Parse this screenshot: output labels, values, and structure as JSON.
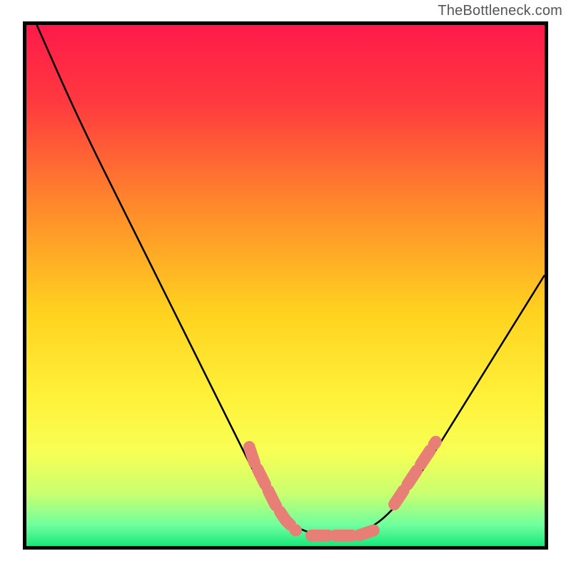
{
  "watermark": "TheBottleneck.com",
  "chart_data": {
    "type": "line",
    "title": "",
    "xlabel": "",
    "ylabel": "",
    "xlim": [
      0,
      100
    ],
    "ylim": [
      0,
      100
    ],
    "series": [
      {
        "name": "main-curve",
        "style": "solid",
        "color": "#000000",
        "points": [
          {
            "x": 2,
            "y": 100
          },
          {
            "x": 10,
            "y": 82
          },
          {
            "x": 20,
            "y": 62
          },
          {
            "x": 30,
            "y": 42
          },
          {
            "x": 40,
            "y": 22
          },
          {
            "x": 48,
            "y": 6
          },
          {
            "x": 55,
            "y": 2
          },
          {
            "x": 62,
            "y": 2
          },
          {
            "x": 68,
            "y": 4
          },
          {
            "x": 75,
            "y": 12
          },
          {
            "x": 85,
            "y": 28
          },
          {
            "x": 95,
            "y": 44
          },
          {
            "x": 100,
            "y": 52
          }
        ]
      },
      {
        "name": "left-marker-band",
        "style": "dashed-markers",
        "color": "#e77f76",
        "points": [
          {
            "x": 43,
            "y": 19
          },
          {
            "x": 44,
            "y": 16
          },
          {
            "x": 46,
            "y": 12
          },
          {
            "x": 48,
            "y": 8
          },
          {
            "x": 50,
            "y": 5
          },
          {
            "x": 52,
            "y": 3
          }
        ]
      },
      {
        "name": "bottom-marker-band",
        "style": "dashed-markers",
        "color": "#e77f76",
        "points": [
          {
            "x": 55,
            "y": 2
          },
          {
            "x": 58,
            "y": 2
          },
          {
            "x": 61,
            "y": 2
          },
          {
            "x": 64,
            "y": 2
          },
          {
            "x": 67,
            "y": 3
          }
        ]
      },
      {
        "name": "right-marker-band",
        "style": "dashed-markers",
        "color": "#e77f76",
        "points": [
          {
            "x": 71,
            "y": 8
          },
          {
            "x": 73,
            "y": 11
          },
          {
            "x": 75,
            "y": 14
          },
          {
            "x": 77,
            "y": 17
          },
          {
            "x": 79,
            "y": 20
          }
        ]
      }
    ],
    "background_gradient_stops": [
      {
        "offset": 0.0,
        "color": "#ff1a4a"
      },
      {
        "offset": 0.15,
        "color": "#ff3a3f"
      },
      {
        "offset": 0.35,
        "color": "#ff8a2b"
      },
      {
        "offset": 0.55,
        "color": "#ffd21f"
      },
      {
        "offset": 0.72,
        "color": "#fff23a"
      },
      {
        "offset": 0.82,
        "color": "#f7ff55"
      },
      {
        "offset": 0.9,
        "color": "#c9ff70"
      },
      {
        "offset": 0.96,
        "color": "#6fff9e"
      },
      {
        "offset": 1.0,
        "color": "#19e87a"
      }
    ]
  }
}
